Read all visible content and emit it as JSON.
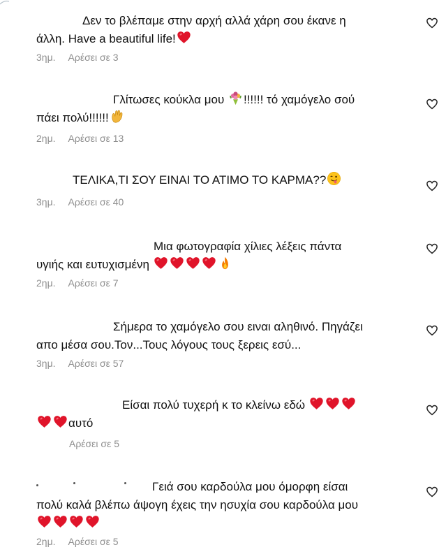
{
  "comments": [
    {
      "lines": [
        [
          {
            "t": "text",
            "v": "Δεν το βλέπαμε στην αρχή αλλά χάρη σου έκανε η"
          }
        ],
        [
          {
            "t": "text",
            "v": "άλλη. Have a beautiful life!"
          },
          {
            "t": "emoji",
            "icon": "red-heart-icon"
          }
        ]
      ],
      "time": "3ημ.",
      "likes": "Αρέσει σε 3"
    },
    {
      "lines": [
        [
          {
            "t": "text",
            "v": "Γλίτωσες κούκλα μου "
          },
          {
            "t": "emoji",
            "icon": "bouquet-icon"
          },
          {
            "t": "text",
            "v": "!!!!!! τό χαμόγελο σού"
          }
        ],
        [
          {
            "t": "text",
            "v": "πάει πολύ!!!!!!"
          },
          {
            "t": "emoji",
            "icon": "clapping-hands-icon"
          }
        ]
      ],
      "time": "2ημ.",
      "likes": "Αρέσει σε 13"
    },
    {
      "lines": [
        [
          {
            "t": "text",
            "v": "ΤΕΛΙΚΑ,ΤΙ ΣΟΥ ΕΙΝΑΙ ΤΟ ΑΤΙΜΟ ΤΟ ΚΑΡΜΑ??"
          },
          {
            "t": "emoji",
            "icon": "winking-tongue-face-icon"
          }
        ]
      ],
      "time": "3ημ.",
      "likes": "Αρέσει σε 40"
    },
    {
      "lines": [
        [
          {
            "t": "text",
            "v": "Μια φωτογραφία χίλιες λέξεις πάντα"
          }
        ],
        [
          {
            "t": "text",
            "v": "υγιής και ευτυχισμένη "
          },
          {
            "t": "emoji",
            "icon": "red-heart-icon"
          },
          {
            "t": "emoji",
            "icon": "red-heart-icon"
          },
          {
            "t": "emoji",
            "icon": "red-heart-icon"
          },
          {
            "t": "emoji",
            "icon": "red-heart-icon"
          },
          {
            "t": "emoji",
            "icon": "fire-icon"
          }
        ]
      ],
      "time": "2ημ.",
      "likes": "Αρέσει σε 7"
    },
    {
      "lines": [
        [
          {
            "t": "text",
            "v": "Σήμερα το χαμόγελο σου ειναι αληθινό. Πηγάζει"
          }
        ],
        [
          {
            "t": "text",
            "v": "απο μέσα σου.Τον...Τους λόγους τους ξερεις εσύ..."
          }
        ]
      ],
      "time": "3ημ.",
      "likes": "Αρέσει σε 57"
    },
    {
      "lines": [
        [
          {
            "t": "text",
            "v": "Είσαι πολύ τυχερή κ το κλείνω εδώ "
          },
          {
            "t": "emoji",
            "icon": "red-heart-icon"
          },
          {
            "t": "emoji",
            "icon": "red-heart-icon"
          },
          {
            "t": "emoji",
            "icon": "red-heart-icon"
          }
        ],
        [
          {
            "t": "emoji",
            "icon": "red-heart-icon"
          },
          {
            "t": "emoji",
            "icon": "red-heart-icon"
          },
          {
            "t": "text",
            "v": "αυτό"
          }
        ]
      ],
      "time": "",
      "likes": "Αρέσει σε 5"
    },
    {
      "lines": [
        [
          {
            "t": "text",
            "v": "Γειά σου καρδούλα μου όμορφη είσαι"
          }
        ],
        [
          {
            "t": "text",
            "v": "πολύ καλά βλέπω άψογη έχεις την ησυχία σου καρδούλα μου"
          }
        ],
        [
          {
            "t": "emoji",
            "icon": "red-heart-icon"
          },
          {
            "t": "emoji",
            "icon": "red-heart-icon"
          },
          {
            "t": "emoji",
            "icon": "red-heart-icon"
          },
          {
            "t": "emoji",
            "icon": "red-heart-icon"
          }
        ]
      ],
      "time": "2ημ.",
      "likes": "Αρέσει σε 5"
    }
  ],
  "like_icon": "heart-outline-icon",
  "colors": {
    "text": "#111111",
    "meta": "#8e8e8e",
    "heart": "#e0142a",
    "background": "#ffffff"
  }
}
